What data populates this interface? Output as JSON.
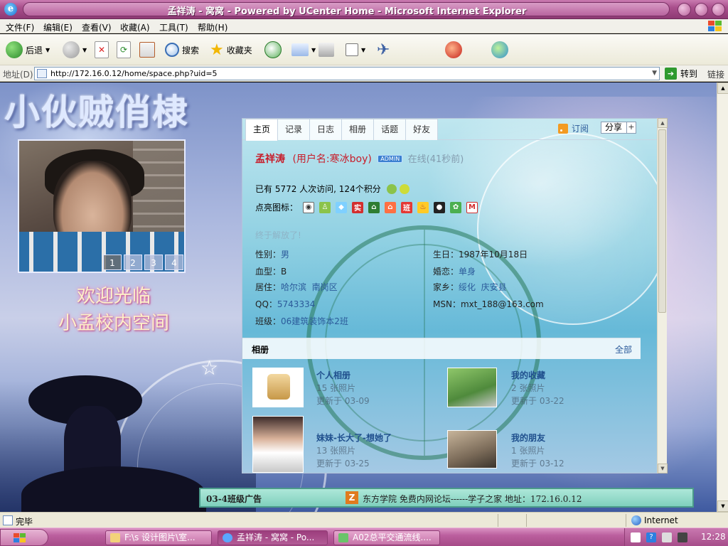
{
  "window": {
    "title": "孟祥涛 - 窝窝 - Powered by UCenter Home - Microsoft Internet Explorer"
  },
  "menu": [
    "文件(F)",
    "编辑(E)",
    "查看(V)",
    "收藏(A)",
    "工具(T)",
    "帮助(H)"
  ],
  "toolbar": {
    "back": "后退",
    "search": "搜索",
    "favorites": "收藏夹"
  },
  "address": {
    "label": "地址(D)",
    "url": "http://172.16.0.12/home/space.php?uid=5",
    "go": "转到",
    "links": "链接"
  },
  "banner": {
    "title": "小伙贼俏棣"
  },
  "photo": {
    "pages": [
      "1",
      "2",
      "3",
      "4"
    ]
  },
  "welcome": {
    "line1": "欢迎光临",
    "line2": "小孟校内空间"
  },
  "tabs": [
    "主页",
    "记录",
    "日志",
    "相册",
    "话题",
    "好友"
  ],
  "panel": {
    "rss": "订阅",
    "share": "分享",
    "share_plus": "+"
  },
  "profile": {
    "name": "孟祥涛",
    "username": "(用户名:寒冰boy)",
    "online": "在线(41秒前)",
    "visits": "已有 5772 人次访问, 124个积分",
    "icons_label": "点亮图标：",
    "status": "终于解放了!"
  },
  "info": {
    "gender_label": "性别：",
    "gender": "男",
    "birthday": "生日：1987年10月18日",
    "blood_label": "血型：",
    "blood": "B",
    "marital_label": "婚恋：",
    "marital": "单身",
    "residence_label": "居住：",
    "residence_city": "哈尔滨",
    "residence_district": "南岗区",
    "hometown_label": "家乡：",
    "hometown_city": "绥化",
    "hometown_county": "庆安县",
    "qq_label": "QQ：",
    "qq": "5743334",
    "msn": "MSN：mxt_188@163.com",
    "class_label": "班级：",
    "class": "06建筑装饰本2班"
  },
  "albums": {
    "title": "相册",
    "all": "全部",
    "items": [
      {
        "name": "个人相册",
        "count": "15 张照片",
        "updated": "更新于 03-09"
      },
      {
        "name": "我的收藏",
        "count": "2 张照片",
        "updated": "更新于 03-22"
      },
      {
        "name": "妹妹-长大了-想她了",
        "count": "13 张照片",
        "updated": "更新于 03-25"
      },
      {
        "name": "我的朋友",
        "count": "1 张照片",
        "updated": "更新于 03-12"
      }
    ]
  },
  "ad": {
    "left": "03-4班级广告",
    "logo": "Z",
    "text": "东方学院   免费内网论坛------学子之家      地址：172.16.0.12"
  },
  "statusbar": {
    "done": "完毕",
    "zone": "Internet"
  },
  "taskbar": {
    "tasks": [
      "F:\\s 设计图片\\室...",
      "孟祥涛 - 窝窝 - Po...",
      "A02总平交通流线...."
    ],
    "clock": "12:28"
  }
}
